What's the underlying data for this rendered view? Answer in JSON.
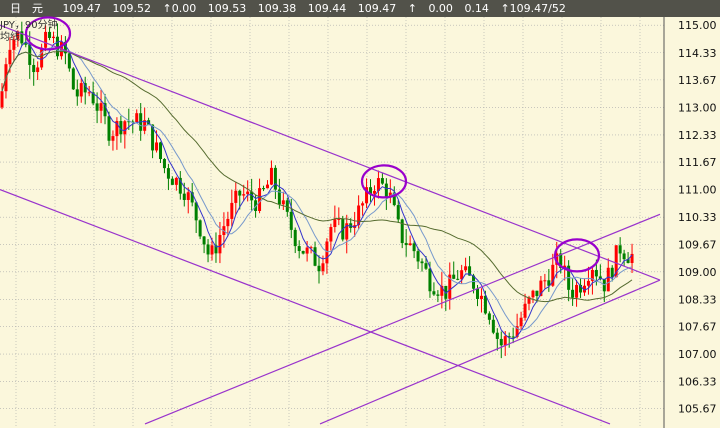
{
  "header": {
    "symbol": "日　元",
    "open": "109.47",
    "high": "109.52",
    "change1": "↑0.00",
    "v1": "109.53",
    "v2": "109.38",
    "v3": "109.44",
    "v4": "109.47",
    "arrow": "↑",
    "change2": "0.00",
    "v5": "0.14",
    "last": "↑109.47/52"
  },
  "overlay": {
    "line1": "JPY，90分钟",
    "line2": "均线"
  },
  "colors": {
    "background": "#fbf7dc",
    "grid": "#aaaaaa",
    "up": "#ff0000",
    "down": "#008000",
    "channel": "#9933cc",
    "ma_fast": "#3333cc",
    "ma_mid": "#7799cc",
    "ma_slow": "#556b2f",
    "highlight": "#9900cc"
  },
  "chart_data": {
    "type": "candlestick",
    "title": "",
    "xlabel": "",
    "ylabel": "",
    "ylim": [
      105.2,
      115.2
    ],
    "y_ticks": [
      "115.00",
      "114.33",
      "113.67",
      "113.00",
      "112.33",
      "111.67",
      "111.00",
      "110.33",
      "109.67",
      "109.00",
      "108.33",
      "107.67",
      "107.00",
      "106.33",
      "105.67"
    ],
    "anchors": [
      [
        0,
        113.0
      ],
      [
        8,
        114.6
      ],
      [
        20,
        114.8
      ],
      [
        35,
        114.0
      ],
      [
        48,
        114.7
      ],
      [
        65,
        114.3
      ],
      [
        75,
        113.3
      ],
      [
        90,
        113.4
      ],
      [
        110,
        112.4
      ],
      [
        125,
        112.7
      ],
      [
        145,
        112.6
      ],
      [
        165,
        111.5
      ],
      [
        185,
        111.0
      ],
      [
        200,
        110.1
      ],
      [
        210,
        109.3
      ],
      [
        225,
        110.2
      ],
      [
        240,
        110.9
      ],
      [
        258,
        110.7
      ],
      [
        272,
        111.3
      ],
      [
        285,
        110.4
      ],
      [
        300,
        109.6
      ],
      [
        320,
        109.2
      ],
      [
        330,
        110.1
      ],
      [
        345,
        110.0
      ],
      [
        360,
        110.5
      ],
      [
        375,
        111.2
      ],
      [
        388,
        111.0
      ],
      [
        400,
        109.9
      ],
      [
        415,
        109.5
      ],
      [
        430,
        108.8
      ],
      [
        445,
        108.5
      ],
      [
        460,
        109.0
      ],
      [
        475,
        108.7
      ],
      [
        490,
        108.0
      ],
      [
        500,
        107.2
      ],
      [
        515,
        107.6
      ],
      [
        530,
        108.3
      ],
      [
        545,
        108.8
      ],
      [
        560,
        109.3
      ],
      [
        570,
        108.5
      ],
      [
        580,
        108.7
      ],
      [
        592,
        109.2
      ],
      [
        605,
        108.7
      ],
      [
        620,
        109.6
      ],
      [
        630,
        109.4
      ]
    ],
    "candles": 160,
    "moving_averages": [
      {
        "color": "#3333cc",
        "period": 5
      },
      {
        "color": "#7799cc",
        "period": 10
      },
      {
        "color": "#556b2f",
        "period": 30
      }
    ],
    "channel_lines": [
      {
        "x1": 0,
        "y1": 115.0,
        "x2": 660,
        "y2": 108.8
      },
      {
        "x1": 0,
        "y1": 111.0,
        "x2": 610,
        "y2": 105.3
      },
      {
        "x1": 145,
        "y1": 105.3,
        "x2": 660,
        "y2": 110.4
      },
      {
        "x1": 320,
        "y1": 105.3,
        "x2": 660,
        "y2": 108.8
      }
    ],
    "highlights": [
      {
        "cx": 48,
        "cy": 114.8
      },
      {
        "cx": 384,
        "cy": 111.2
      },
      {
        "cx": 577,
        "cy": 109.4
      }
    ],
    "grid": true
  }
}
